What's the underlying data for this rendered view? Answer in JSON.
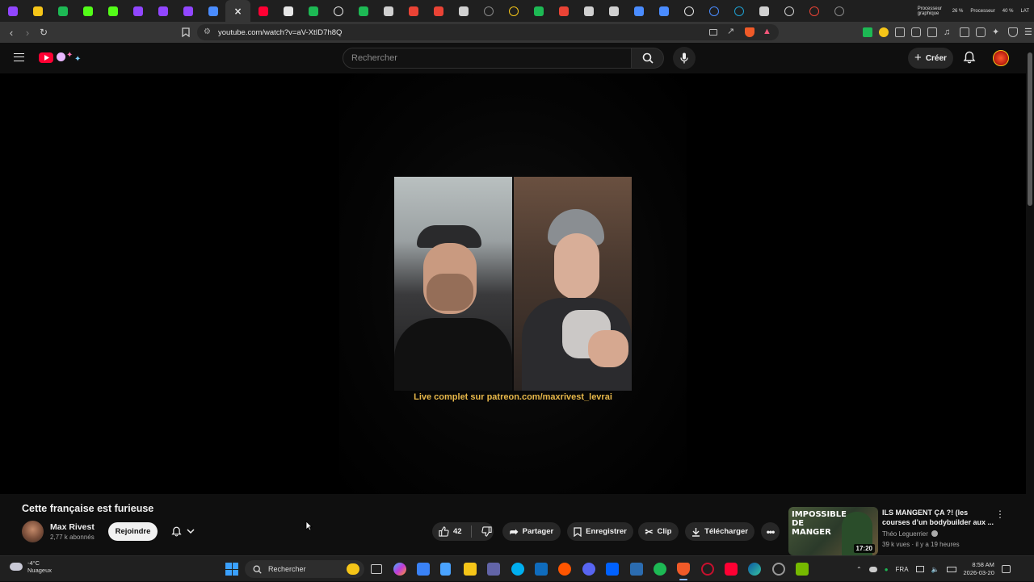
{
  "browser": {
    "url": "youtube.com/watch?v=aV-XtID7h8Q",
    "tabs": [
      {
        "icon": "twitch-icon",
        "color": "#9146ff"
      },
      {
        "icon": "mask-icon",
        "color": "#f5c518"
      },
      {
        "icon": "spotify-like-icon",
        "color": "#1db954"
      },
      {
        "icon": "kick-icon",
        "color": "#53fc18"
      },
      {
        "icon": "kick-icon",
        "color": "#53fc18"
      },
      {
        "icon": "twitch-icon",
        "color": "#9146ff"
      },
      {
        "icon": "twitch-icon",
        "color": "#9146ff"
      },
      {
        "icon": "twitch-icon",
        "color": "#9146ff"
      },
      {
        "icon": "grid-icon",
        "color": "#4a8cff"
      },
      {
        "icon": "close-icon",
        "color": "#e6e6e6",
        "active": true
      },
      {
        "icon": "youtube-icon",
        "color": "#ff0033"
      },
      {
        "icon": "tiktok-icon",
        "color": "#e6e6e6"
      },
      {
        "icon": "m-icon",
        "color": "#1db954"
      },
      {
        "icon": "circle-icon",
        "color": "#e6e6e6"
      },
      {
        "icon": "plus-circle-icon",
        "color": "#1db954"
      },
      {
        "icon": "shield-icon",
        "color": "#d0d0d0"
      },
      {
        "icon": "gmail-icon",
        "color": "#ea4335"
      },
      {
        "icon": "gmail-icon",
        "color": "#ea4335"
      },
      {
        "icon": "link-icon",
        "color": "#d0d0d0"
      },
      {
        "icon": "loading-icon",
        "color": "#888888"
      },
      {
        "icon": "circle-icon",
        "color": "#f5c518"
      },
      {
        "icon": "dash-icon",
        "color": "#1db954"
      },
      {
        "icon": "a-icon",
        "color": "#ea4335"
      },
      {
        "icon": "grid-icon",
        "color": "#d0d0d0"
      },
      {
        "icon": "grid-icon",
        "color": "#d0d0d0"
      },
      {
        "icon": "plus-icon",
        "color": "#4a8cff"
      },
      {
        "icon": "plus-icon",
        "color": "#4a8cff"
      },
      {
        "icon": "circle-icon",
        "color": "#e6e6e6"
      },
      {
        "icon": "globe-icon",
        "color": "#4a8cff"
      },
      {
        "icon": "globe-icon",
        "color": "#1fa0d0"
      },
      {
        "icon": "jd-icon",
        "color": "#d0d0d0"
      },
      {
        "icon": "globe-icon",
        "color": "#d0d0d0"
      },
      {
        "icon": "record-icon",
        "color": "#ea4335"
      },
      {
        "icon": "loading-icon",
        "color": "#888888"
      }
    ],
    "stats": {
      "gpu_label": "Processeur graphique",
      "gpu_value": "26 %",
      "cpu_label": "Processeur",
      "cpu_value": "40 %",
      "lat_label": "LAT"
    }
  },
  "youtube": {
    "search_placeholder": "Rechercher",
    "create_label": "Créer",
    "video": {
      "caption": "Live complet sur patreon.com/maxrivest_levrai",
      "title": "Cette française est furieuse",
      "channel": "Max Rivest",
      "subscribers": "2,77 k abonnés",
      "join_label": "Rejoindre",
      "likes": "42",
      "share_label": "Partager",
      "save_label": "Enregistrer",
      "clip_label": "Clip",
      "download_label": "Télécharger"
    },
    "recommendation": {
      "title": "ILS MANGENT ÇA ?! (les courses d’un bodybuilder aux ...",
      "channel": "Théo Leguerrier",
      "meta": "39 k vues · il y a 19 heures",
      "duration": "17:20",
      "thumb_text": "IMPOSSIBLE DE MANGER"
    }
  },
  "taskbar": {
    "weather_temp": "-4°C",
    "weather_cond": "Nuageux",
    "search_label": "Rechercher",
    "lang": "FRA",
    "time": "8:58 AM",
    "date": "2026-03-20"
  }
}
